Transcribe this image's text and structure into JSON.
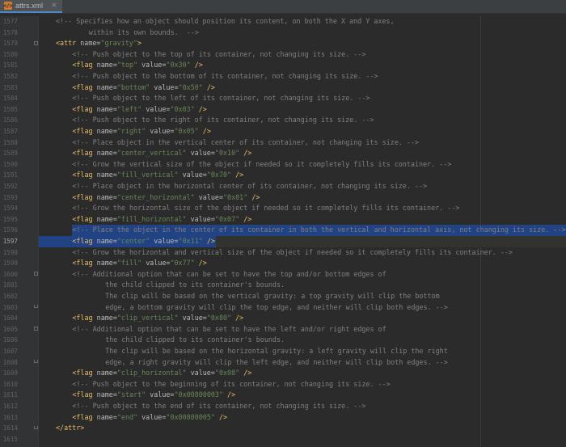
{
  "tab": {
    "icon": "xml-file-icon",
    "filename": "attrs.xml",
    "close": "×"
  },
  "lines": [
    {
      "n": "1577",
      "indent": 1,
      "parts": [
        {
          "t": "c",
          "v": "<!-- Specifies how an object should position its content, on both the X and Y axes,"
        }
      ]
    },
    {
      "n": "1578",
      "indent": 3,
      "parts": [
        {
          "t": "c",
          "v": "within its own bounds.  -->"
        }
      ]
    },
    {
      "n": "1579",
      "indent": 1,
      "fold": "start",
      "parts": [
        {
          "t": "tag",
          "v": "<attr"
        },
        {
          "t": "p",
          "v": " "
        },
        {
          "t": "attr",
          "v": "name="
        },
        {
          "t": "str",
          "v": "\"gravity\""
        },
        {
          "t": "tag",
          "v": ">"
        }
      ]
    },
    {
      "n": "1580",
      "indent": 2,
      "parts": [
        {
          "t": "c",
          "v": "<!-- Push object to the top of its container, not changing its size. -->"
        }
      ]
    },
    {
      "n": "1581",
      "indent": 2,
      "parts": [
        {
          "t": "tag",
          "v": "<flag"
        },
        {
          "t": "p",
          "v": " "
        },
        {
          "t": "attr",
          "v": "name="
        },
        {
          "t": "str",
          "v": "\"top\""
        },
        {
          "t": "p",
          "v": " "
        },
        {
          "t": "attr",
          "v": "value="
        },
        {
          "t": "str",
          "v": "\"0x30\""
        },
        {
          "t": "p",
          "v": " "
        },
        {
          "t": "tag",
          "v": "/>"
        }
      ]
    },
    {
      "n": "1582",
      "indent": 2,
      "parts": [
        {
          "t": "c",
          "v": "<!-- Push object to the bottom of its container, not changing its size. -->"
        }
      ]
    },
    {
      "n": "1583",
      "indent": 2,
      "parts": [
        {
          "t": "tag",
          "v": "<flag"
        },
        {
          "t": "p",
          "v": " "
        },
        {
          "t": "attr",
          "v": "name="
        },
        {
          "t": "str",
          "v": "\"bottom\""
        },
        {
          "t": "p",
          "v": " "
        },
        {
          "t": "attr",
          "v": "value="
        },
        {
          "t": "str",
          "v": "\"0x50\""
        },
        {
          "t": "p",
          "v": " "
        },
        {
          "t": "tag",
          "v": "/>"
        }
      ]
    },
    {
      "n": "1584",
      "indent": 2,
      "parts": [
        {
          "t": "c",
          "v": "<!-- Push object to the left of its container, not changing its size. -->"
        }
      ]
    },
    {
      "n": "1585",
      "indent": 2,
      "parts": [
        {
          "t": "tag",
          "v": "<flag"
        },
        {
          "t": "p",
          "v": " "
        },
        {
          "t": "attr",
          "v": "name="
        },
        {
          "t": "str",
          "v": "\"left\""
        },
        {
          "t": "p",
          "v": " "
        },
        {
          "t": "attr",
          "v": "value="
        },
        {
          "t": "str",
          "v": "\"0x03\""
        },
        {
          "t": "p",
          "v": " "
        },
        {
          "t": "tag",
          "v": "/>"
        }
      ]
    },
    {
      "n": "1586",
      "indent": 2,
      "parts": [
        {
          "t": "c",
          "v": "<!-- Push object to the right of its container, not changing its size. -->"
        }
      ]
    },
    {
      "n": "1587",
      "indent": 2,
      "parts": [
        {
          "t": "tag",
          "v": "<flag"
        },
        {
          "t": "p",
          "v": " "
        },
        {
          "t": "attr",
          "v": "name="
        },
        {
          "t": "str",
          "v": "\"right\""
        },
        {
          "t": "p",
          "v": " "
        },
        {
          "t": "attr",
          "v": "value="
        },
        {
          "t": "str",
          "v": "\"0x05\""
        },
        {
          "t": "p",
          "v": " "
        },
        {
          "t": "tag",
          "v": "/>"
        }
      ]
    },
    {
      "n": "1588",
      "indent": 2,
      "parts": [
        {
          "t": "c",
          "v": "<!-- Place object in the vertical center of its container, not changing its size. -->"
        }
      ]
    },
    {
      "n": "1589",
      "indent": 2,
      "parts": [
        {
          "t": "tag",
          "v": "<flag"
        },
        {
          "t": "p",
          "v": " "
        },
        {
          "t": "attr",
          "v": "name="
        },
        {
          "t": "str",
          "v": "\"center_vertical\""
        },
        {
          "t": "p",
          "v": " "
        },
        {
          "t": "attr",
          "v": "value="
        },
        {
          "t": "str",
          "v": "\"0x10\""
        },
        {
          "t": "p",
          "v": " "
        },
        {
          "t": "tag",
          "v": "/>"
        }
      ]
    },
    {
      "n": "1590",
      "indent": 2,
      "parts": [
        {
          "t": "c",
          "v": "<!-- Grow the vertical size of the object if needed so it completely fills its container. -->"
        }
      ]
    },
    {
      "n": "1591",
      "indent": 2,
      "parts": [
        {
          "t": "tag",
          "v": "<flag"
        },
        {
          "t": "p",
          "v": " "
        },
        {
          "t": "attr",
          "v": "name="
        },
        {
          "t": "str",
          "v": "\"fill_vertical\""
        },
        {
          "t": "p",
          "v": " "
        },
        {
          "t": "attr",
          "v": "value="
        },
        {
          "t": "str",
          "v": "\"0x70\""
        },
        {
          "t": "p",
          "v": " "
        },
        {
          "t": "tag",
          "v": "/>"
        }
      ]
    },
    {
      "n": "1592",
      "indent": 2,
      "parts": [
        {
          "t": "c",
          "v": "<!-- Place object in the horizontal center of its container, not changing its size. -->"
        }
      ]
    },
    {
      "n": "1593",
      "indent": 2,
      "parts": [
        {
          "t": "tag",
          "v": "<flag"
        },
        {
          "t": "p",
          "v": " "
        },
        {
          "t": "attr",
          "v": "name="
        },
        {
          "t": "str",
          "v": "\"center_horizontal\""
        },
        {
          "t": "p",
          "v": " "
        },
        {
          "t": "attr",
          "v": "value="
        },
        {
          "t": "str",
          "v": "\"0x01\""
        },
        {
          "t": "p",
          "v": " "
        },
        {
          "t": "tag",
          "v": "/>"
        }
      ]
    },
    {
      "n": "1594",
      "indent": 2,
      "parts": [
        {
          "t": "c",
          "v": "<!-- Grow the horizontal size of the object if needed so it completely fills its container. -->"
        }
      ]
    },
    {
      "n": "1595",
      "indent": 2,
      "parts": [
        {
          "t": "tag",
          "v": "<flag"
        },
        {
          "t": "p",
          "v": " "
        },
        {
          "t": "attr",
          "v": "name="
        },
        {
          "t": "str",
          "v": "\"fill_horizontal\""
        },
        {
          "t": "p",
          "v": " "
        },
        {
          "t": "attr",
          "v": "value="
        },
        {
          "t": "str",
          "v": "\"0x07\""
        },
        {
          "t": "p",
          "v": " "
        },
        {
          "t": "tag",
          "v": "/>"
        }
      ]
    },
    {
      "n": "1596",
      "indent": 2,
      "selected": "full",
      "parts": [
        {
          "t": "c",
          "v": "<!-- Place the object in the center of its container in both the vertical and horizontal axis, not changing its size. -->"
        }
      ]
    },
    {
      "n": "1597",
      "indent": 2,
      "active": true,
      "selected": "partial",
      "parts": [
        {
          "t": "tag",
          "v": "<flag"
        },
        {
          "t": "p",
          "v": " "
        },
        {
          "t": "attr",
          "v": "name="
        },
        {
          "t": "str",
          "v": "\"center\""
        },
        {
          "t": "p",
          "v": " "
        },
        {
          "t": "attr",
          "v": "value="
        },
        {
          "t": "str",
          "v": "\"0x11\""
        },
        {
          "t": "p",
          "v": " "
        },
        {
          "t": "tag",
          "v": "/>"
        }
      ]
    },
    {
      "n": "1598",
      "indent": 2,
      "parts": [
        {
          "t": "c",
          "v": "<!-- Grow the horizontal and vertical size of the object if needed so it completely fills its container. -->"
        }
      ]
    },
    {
      "n": "1599",
      "indent": 2,
      "parts": [
        {
          "t": "tag",
          "v": "<flag"
        },
        {
          "t": "p",
          "v": " "
        },
        {
          "t": "attr",
          "v": "name="
        },
        {
          "t": "str",
          "v": "\"fill\""
        },
        {
          "t": "p",
          "v": " "
        },
        {
          "t": "attr",
          "v": "value="
        },
        {
          "t": "str",
          "v": "\"0x77\""
        },
        {
          "t": "p",
          "v": " "
        },
        {
          "t": "tag",
          "v": "/>"
        }
      ]
    },
    {
      "n": "1600",
      "indent": 2,
      "fold": "start",
      "parts": [
        {
          "t": "c",
          "v": "<!-- Additional option that can be set to have the top and/or bottom edges of"
        }
      ]
    },
    {
      "n": "1601",
      "indent": 4,
      "parts": [
        {
          "t": "c",
          "v": "the child clipped to its container's bounds."
        }
      ]
    },
    {
      "n": "1602",
      "indent": 4,
      "parts": [
        {
          "t": "c",
          "v": "The clip will be based on the vertical gravity: a top gravity will clip the bottom"
        }
      ]
    },
    {
      "n": "1603",
      "indent": 4,
      "fold": "end",
      "parts": [
        {
          "t": "c",
          "v": "edge, a bottom gravity will clip the top edge, and neither will clip both edges. -->"
        }
      ]
    },
    {
      "n": "1604",
      "indent": 2,
      "parts": [
        {
          "t": "tag",
          "v": "<flag"
        },
        {
          "t": "p",
          "v": " "
        },
        {
          "t": "attr",
          "v": "name="
        },
        {
          "t": "str",
          "v": "\"clip_vertical\""
        },
        {
          "t": "p",
          "v": " "
        },
        {
          "t": "attr",
          "v": "value="
        },
        {
          "t": "str",
          "v": "\"0x80\""
        },
        {
          "t": "p",
          "v": " "
        },
        {
          "t": "tag",
          "v": "/>"
        }
      ]
    },
    {
      "n": "1605",
      "indent": 2,
      "fold": "start",
      "parts": [
        {
          "t": "c",
          "v": "<!-- Additional option that can be set to have the left and/or right edges of"
        }
      ]
    },
    {
      "n": "1606",
      "indent": 4,
      "parts": [
        {
          "t": "c",
          "v": "the child clipped to its container's bounds."
        }
      ]
    },
    {
      "n": "1607",
      "indent": 4,
      "parts": [
        {
          "t": "c",
          "v": "The clip will be based on the horizontal gravity: a left gravity will clip the right"
        }
      ]
    },
    {
      "n": "1608",
      "indent": 4,
      "fold": "end",
      "parts": [
        {
          "t": "c",
          "v": "edge, a right gravity will clip the left edge, and neither will clip both edges. -->"
        }
      ]
    },
    {
      "n": "1609",
      "indent": 2,
      "parts": [
        {
          "t": "tag",
          "v": "<flag"
        },
        {
          "t": "p",
          "v": " "
        },
        {
          "t": "attr",
          "v": "name="
        },
        {
          "t": "str",
          "v": "\"clip_horizontal\""
        },
        {
          "t": "p",
          "v": " "
        },
        {
          "t": "attr",
          "v": "value="
        },
        {
          "t": "str",
          "v": "\"0x08\""
        },
        {
          "t": "p",
          "v": " "
        },
        {
          "t": "tag",
          "v": "/>"
        }
      ]
    },
    {
      "n": "1610",
      "indent": 2,
      "parts": [
        {
          "t": "c",
          "v": "<!-- Push object to the beginning of its container, not changing its size. -->"
        }
      ]
    },
    {
      "n": "1611",
      "indent": 2,
      "parts": [
        {
          "t": "tag",
          "v": "<flag"
        },
        {
          "t": "p",
          "v": " "
        },
        {
          "t": "attr",
          "v": "name="
        },
        {
          "t": "str",
          "v": "\"start\""
        },
        {
          "t": "p",
          "v": " "
        },
        {
          "t": "attr",
          "v": "value="
        },
        {
          "t": "str",
          "v": "\"0x00800003\""
        },
        {
          "t": "p",
          "v": " "
        },
        {
          "t": "tag",
          "v": "/>"
        }
      ]
    },
    {
      "n": "1612",
      "indent": 2,
      "parts": [
        {
          "t": "c",
          "v": "<!-- Push object to the end of its container, not changing its size. -->"
        }
      ]
    },
    {
      "n": "1613",
      "indent": 2,
      "parts": [
        {
          "t": "tag",
          "v": "<flag"
        },
        {
          "t": "p",
          "v": " "
        },
        {
          "t": "attr",
          "v": "name="
        },
        {
          "t": "str",
          "v": "\"end\""
        },
        {
          "t": "p",
          "v": " "
        },
        {
          "t": "attr",
          "v": "value="
        },
        {
          "t": "str",
          "v": "\"0x00800005\""
        },
        {
          "t": "p",
          "v": " "
        },
        {
          "t": "tag",
          "v": "/>"
        }
      ]
    },
    {
      "n": "1614",
      "indent": 1,
      "fold": "end",
      "parts": [
        {
          "t": "tag",
          "v": "</attr>"
        }
      ]
    },
    {
      "n": "1615",
      "indent": 0,
      "parts": []
    }
  ]
}
